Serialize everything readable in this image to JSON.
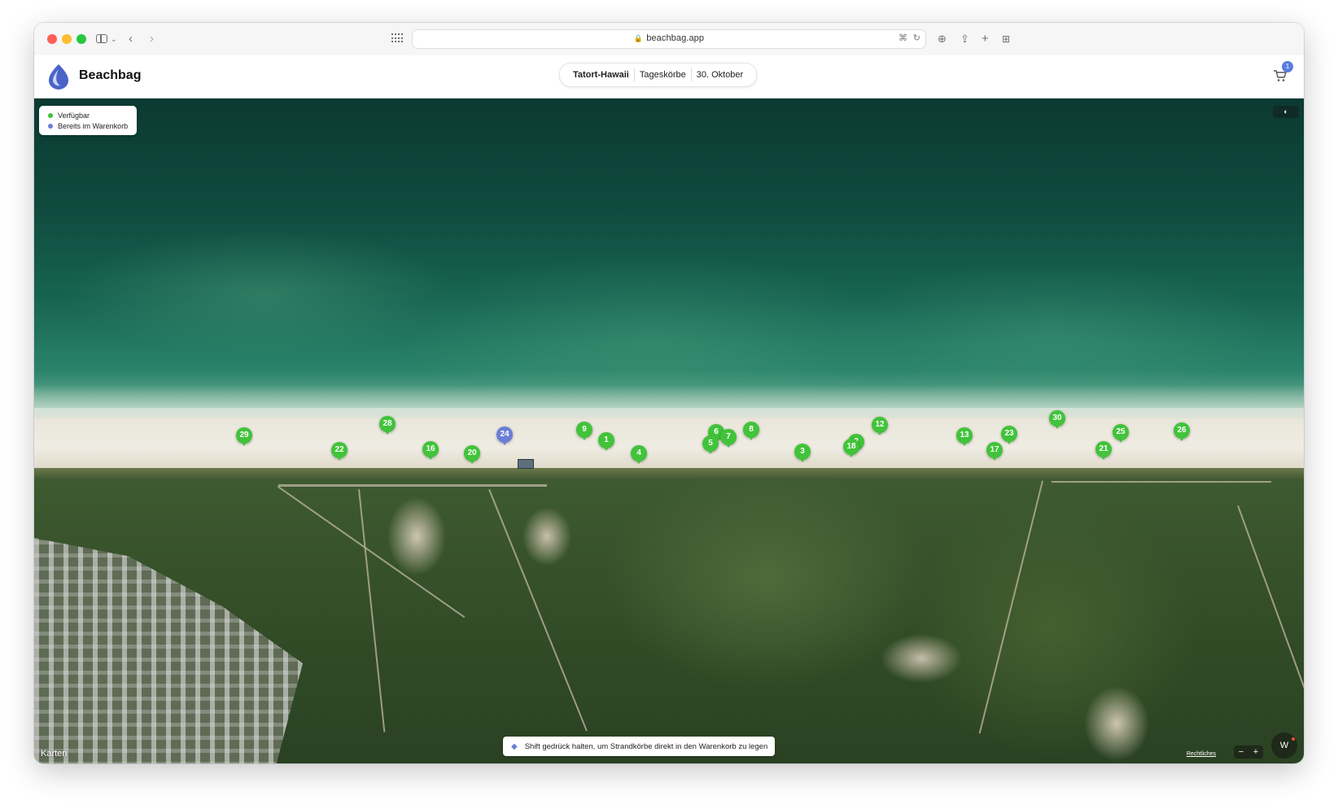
{
  "browser": {
    "url": "beachbag.app"
  },
  "header": {
    "brand": "Beachbag",
    "location": "Tatort-Hawaii",
    "category": "Tageskörbe",
    "date": "30. Oktober",
    "cart_count": "1"
  },
  "legend": {
    "available_label": "Verfügbar",
    "available_color": "#41c33a",
    "in_cart_label": "Bereits im Warenkorb",
    "in_cart_color": "#6a7ed6"
  },
  "map": {
    "provider_label": "Karten",
    "legal_label": "Rechtliches",
    "zoom_out": "−",
    "zoom_in": "+",
    "compass_label": "W",
    "hint_text": "Shift gedrück halten, um Strandkörbe direkt in den Warenkorb zu legen"
  },
  "pins": [
    {
      "label": "29",
      "status": "available"
    },
    {
      "label": "22",
      "status": "available"
    },
    {
      "label": "28",
      "status": "available"
    },
    {
      "label": "16",
      "status": "available"
    },
    {
      "label": "20",
      "status": "available"
    },
    {
      "label": "24",
      "status": "in_cart"
    },
    {
      "label": "9",
      "status": "available"
    },
    {
      "label": "1",
      "status": "available"
    },
    {
      "label": "4",
      "status": "available"
    },
    {
      "label": "6",
      "status": "available"
    },
    {
      "label": "5",
      "status": "available"
    },
    {
      "label": "7",
      "status": "available"
    },
    {
      "label": "8",
      "status": "available"
    },
    {
      "label": "3",
      "status": "available"
    },
    {
      "label": "2",
      "status": "available"
    },
    {
      "label": "18",
      "status": "available"
    },
    {
      "label": "12",
      "status": "available"
    },
    {
      "label": "13",
      "status": "available"
    },
    {
      "label": "17",
      "status": "available"
    },
    {
      "label": "23",
      "status": "available"
    },
    {
      "label": "30",
      "status": "available"
    },
    {
      "label": "21",
      "status": "available"
    },
    {
      "label": "25",
      "status": "available"
    },
    {
      "label": "26",
      "status": "available"
    }
  ]
}
